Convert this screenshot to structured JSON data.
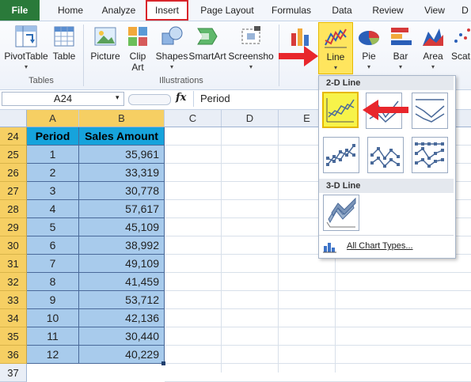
{
  "tabs": [
    "File",
    "Home",
    "Analyze",
    "Insert",
    "Page Layout",
    "Formulas",
    "Data",
    "Review",
    "View",
    "D"
  ],
  "ribbon": {
    "buttons": {
      "pivottable": "PivotTable",
      "table": "Table",
      "picture": "Picture",
      "clipart_1": "Clip",
      "clipart_2": "Art",
      "shapes": "Shapes",
      "smartart": "SmartArt",
      "screenshot": "Screensho",
      "line": "Line",
      "pie": "Pie",
      "bar": "Bar",
      "area": "Area",
      "scatter": "Scat"
    },
    "groups": {
      "tables": "Tables",
      "illustrations": "Illustrations"
    }
  },
  "formula_bar": {
    "name_box": "A24",
    "fx": "fx",
    "content": "Period"
  },
  "columns": [
    "A",
    "B",
    "C",
    "D",
    "E"
  ],
  "row_numbers": [
    "24",
    "25",
    "26",
    "27",
    "28",
    "29",
    "30",
    "31",
    "32",
    "33",
    "34",
    "35",
    "36",
    "37"
  ],
  "table": {
    "headers": [
      "Period",
      "Sales Amount"
    ],
    "rows": [
      [
        "1",
        "35,961"
      ],
      [
        "2",
        "33,319"
      ],
      [
        "3",
        "30,778"
      ],
      [
        "4",
        "57,617"
      ],
      [
        "5",
        "45,109"
      ],
      [
        "6",
        "38,992"
      ],
      [
        "7",
        "49,109"
      ],
      [
        "8",
        "41,459"
      ],
      [
        "9",
        "53,712"
      ],
      [
        "10",
        "42,136"
      ],
      [
        "11",
        "30,440"
      ],
      [
        "12",
        "40,229"
      ]
    ]
  },
  "dropdown": {
    "section_2d": "2-D Line",
    "section_3d": "3-D Line",
    "all_chart_types": "All Chart Types..."
  },
  "colors": {
    "accent_red": "#e8262c",
    "highlight_yellow": "#f7f34a",
    "header_blue": "#16a3dc",
    "cell_blue": "#a8cbec",
    "file_green": "#2a7a3a"
  }
}
